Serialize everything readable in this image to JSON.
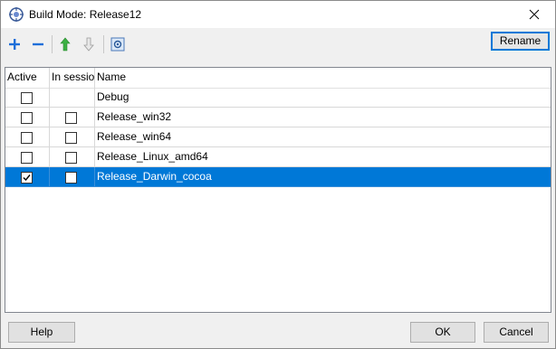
{
  "window": {
    "title": "Build Mode: Release12"
  },
  "toolbar": {
    "rename_label": "Rename"
  },
  "table": {
    "headers": [
      "Active",
      "In sessio",
      "Name"
    ],
    "rows": [
      {
        "name": "Debug",
        "active": false,
        "in_session": null
      },
      {
        "name": "Release_win32",
        "active": false,
        "in_session": false
      },
      {
        "name": "Release_win64",
        "active": false,
        "in_session": false
      },
      {
        "name": "Release_Linux_amd64",
        "active": false,
        "in_session": false
      },
      {
        "name": "Release_Darwin_cocoa",
        "active": true,
        "in_session": false,
        "selected": true
      }
    ]
  },
  "buttons": {
    "help": "Help",
    "ok": "OK",
    "cancel": "Cancel"
  },
  "colors": {
    "selection": "#0078d7",
    "add_icon": "#1e6fd9",
    "up_arrow": "#3cb043"
  }
}
